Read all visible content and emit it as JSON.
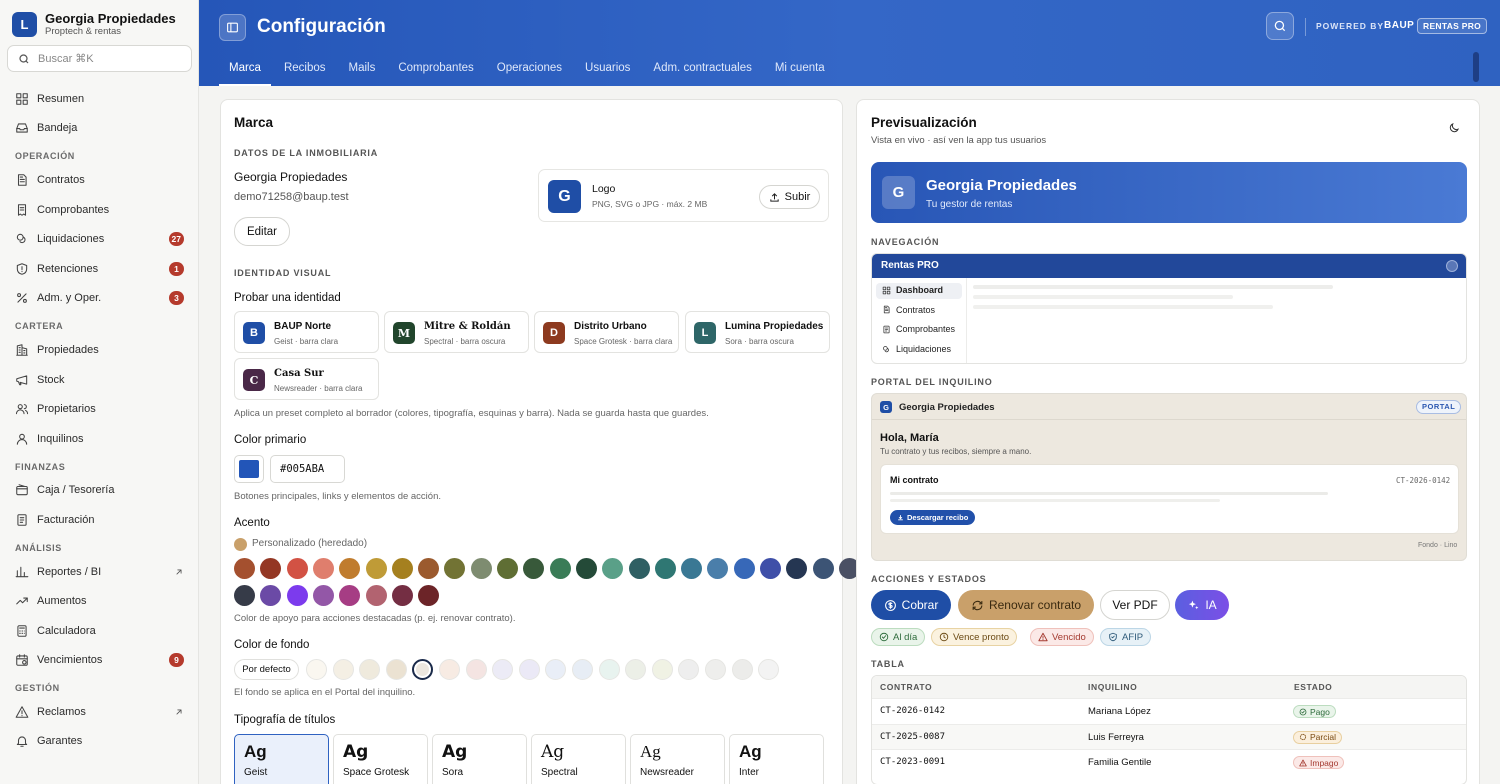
{
  "sidebar": {
    "brand_initial": "L",
    "brand_name": "Georgia Propiedades",
    "brand_sub": "Proptech & rentas",
    "search_placeholder": "Buscar ⌘K",
    "top_items": [
      {
        "label": "Resumen",
        "icon": "grid-icon"
      },
      {
        "label": "Bandeja",
        "icon": "inbox-icon"
      }
    ],
    "sections": [
      {
        "title": "OPERACIÓN",
        "items": [
          {
            "label": "Contratos",
            "icon": "document-icon"
          },
          {
            "label": "Comprobantes",
            "icon": "receipt-icon"
          },
          {
            "label": "Liquidaciones",
            "icon": "coins-icon",
            "badge": "27"
          },
          {
            "label": "Retenciones",
            "icon": "shield-icon",
            "badge": "1"
          },
          {
            "label": "Adm. y Oper.",
            "icon": "percent-icon",
            "badge": "3"
          }
        ]
      },
      {
        "title": "CARTERA",
        "items": [
          {
            "label": "Propiedades",
            "icon": "building-icon"
          },
          {
            "label": "Stock",
            "icon": "megaphone-icon"
          },
          {
            "label": "Propietarios",
            "icon": "users-icon"
          },
          {
            "label": "Inquilinos",
            "icon": "user-icon"
          }
        ]
      },
      {
        "title": "FINANZAS",
        "items": [
          {
            "label": "Caja / Tesorería",
            "icon": "wallet-icon"
          },
          {
            "label": "Facturación",
            "icon": "invoice-icon"
          }
        ]
      },
      {
        "title": "ANÁLISIS",
        "items": [
          {
            "label": "Reportes / BI",
            "icon": "chart-icon",
            "external": true
          },
          {
            "label": "Aumentos",
            "icon": "trend-icon"
          },
          {
            "label": "Calculadora",
            "icon": "calculator-icon"
          },
          {
            "label": "Vencimientos",
            "icon": "calendar-icon",
            "badge": "9"
          }
        ]
      },
      {
        "title": "GESTIÓN",
        "items": [
          {
            "label": "Reclamos",
            "icon": "warning-icon",
            "external": true
          },
          {
            "label": "Garantes",
            "icon": "bell-icon"
          }
        ]
      }
    ]
  },
  "header": {
    "title": "Configuración",
    "powered_by": "POWERED BY",
    "powered_brand": "BAUP",
    "pro_badge": "RENTAS PRO",
    "tabs": [
      "Marca",
      "Recibos",
      "Mails",
      "Comprobantes",
      "Operaciones",
      "Usuarios",
      "Adm. contractuales",
      "Mi cuenta"
    ],
    "active_tab": "Marca"
  },
  "marca": {
    "title": "Marca",
    "datos_label": "DATOS DE LA INMOBILIARIA",
    "company_name": "Georgia Propiedades",
    "email": "demo71258@baup.test",
    "edit_label": "Editar",
    "logo_initial": "G",
    "logo_title": "Logo",
    "logo_hint": "PNG, SVG o JPG · máx. 2 MB",
    "upload_label": "Subir",
    "identity_label": "IDENTIDAD VISUAL",
    "try_label": "Probar una identidad",
    "presets": [
      {
        "initial": "B",
        "name": "BAUP Norte",
        "sub": "Geist · barra clara",
        "color": "#1f4ea6"
      },
      {
        "initial": "M",
        "name": "Mitre & Roldán",
        "sub": "Spectral · barra oscura",
        "color": "#21452c"
      },
      {
        "initial": "D",
        "name": "Distrito Urbano",
        "sub": "Space Grotesk · barra clara",
        "color": "#8d3a1f"
      },
      {
        "initial": "L",
        "name": "Lumina Propiedades",
        "sub": "Sora · barra oscura",
        "color": "#2e6668"
      },
      {
        "initial": "C",
        "name": "Casa Sur",
        "sub": "Newsreader · barra clara",
        "color": "#4a2848"
      }
    ],
    "preset_hint": "Aplica un preset completo al borrador (colores, tipografía, esquinas y barra). Nada se guarda hasta que guardes.",
    "primary_label": "Color primario",
    "primary_color": "#2255B8",
    "primary_hex": "#005ABA",
    "primary_hint": "Botones principales, links y elementos de acción.",
    "accent_label": "Acento",
    "accent_custom": "Personalizado (heredado)",
    "accent_custom_color": "#c9a06a",
    "accent_colors": [
      "#a4502f",
      "#943724",
      "#d25244",
      "#df7e6d",
      "#c07c2e",
      "#bf9b37",
      "#a5801f",
      "#9b5a2e",
      "#727334",
      "#7e8c70",
      "#5f6e34",
      "#38593a",
      "#3a7c57",
      "#244a38",
      "#5aa088",
      "#2f5f63",
      "#2f7773",
      "#3a7894",
      "#4a7eaa",
      "#3768b8",
      "#3f4fa8",
      "#253652",
      "#3c5475",
      "#4a5064",
      "#363b48",
      "#6b4aa6",
      "#7c3bed",
      "#9357a7",
      "#a63d84",
      "#b26370",
      "#742e43",
      "#6c2428"
    ],
    "accent_hint": "Color de apoyo para acciones destacadas (p. ej. renovar contrato).",
    "bg_label": "Color de fondo",
    "bg_default": "Por defecto",
    "bg_colors": [
      "#faf7f0",
      "#f4efe4",
      "#efeadd",
      "#ebe2d2",
      "#ece7df",
      "#f7ebe3",
      "#f4e4e2",
      "#ecebf6",
      "#ebe9f6",
      "#e9eef7",
      "#e7edf5",
      "#e8f3ef",
      "#ecefe7",
      "#f0f2e4",
      "#eeeeee",
      "#eeeeec",
      "#ececea",
      "#f3f3f3"
    ],
    "bg_selected_index": 4,
    "bg_hint": "El fondo se aplica en el Portal del inquilino.",
    "typo_label": "Tipografía de títulos",
    "typo": [
      {
        "sample": "Ag",
        "name": "Geist"
      },
      {
        "sample": "Ag",
        "name": "Space Grotesk"
      },
      {
        "sample": "Ag",
        "name": "Sora"
      },
      {
        "sample": "Ag",
        "name": "Spectral"
      },
      {
        "sample": "Ag",
        "name": "Newsreader"
      },
      {
        "sample": "Ag",
        "name": "Inter"
      }
    ]
  },
  "preview": {
    "title": "Previsualización",
    "subtitle": "Vista en vivo · así ven la app tus usuarios",
    "hero_initial": "G",
    "hero_title": "Georgia Propiedades",
    "hero_sub": "Tu gestor de rentas",
    "nav_label": "NAVEGACIÓN",
    "nav_bar_title": "Rentas PRO",
    "nav_items": [
      "Dashboard",
      "Contratos",
      "Comprobantes",
      "Liquidaciones"
    ],
    "portal_label": "PORTAL DEL INQUILINO",
    "portal_initial": "G",
    "portal_company": "Georgia Propiedades",
    "portal_badge": "PORTAL",
    "portal_greeting": "Hola, María",
    "portal_sub": "Tu contrato y tus recibos, siempre a mano.",
    "portal_contract_title": "Mi contrato",
    "portal_contract_id": "CT-2026-0142",
    "portal_download": "Descargar recibo",
    "portal_footer": "Fondo · Lino",
    "actions_label": "ACCIONES Y ESTADOS",
    "btn_cobrar": "Cobrar",
    "btn_renovar": "Renovar contrato",
    "btn_pdf": "Ver PDF",
    "btn_ia": "IA",
    "chips": [
      {
        "label": "Al día",
        "fg": "#2d6b3b",
        "bg": "#e9f4ea",
        "bd": "#bcdcbf"
      },
      {
        "label": "Vence pronto",
        "fg": "#6b4a14",
        "bg": "#fbf2df",
        "bd": "#e8d3a3"
      },
      {
        "label": "Vencido",
        "fg": "#a43a30",
        "bg": "#fbe9e7",
        "bd": "#efc1bb"
      },
      {
        "label": "AFIP",
        "fg": "#2f5b7a",
        "bg": "#e7f1f7",
        "bd": "#bcd6e6"
      }
    ],
    "table_label": "TABLA",
    "table_headers": [
      "CONTRATO",
      "INQUILINO",
      "ESTADO"
    ],
    "table_rows": [
      {
        "contrato": "CT-2026-0142",
        "inquilino": "Mariana López",
        "estado": "Pago",
        "fg": "#2d6b3b",
        "bg": "#e9f4ea",
        "bd": "#bcdcbf"
      },
      {
        "contrato": "CT-2025-0087",
        "inquilino": "Luis Ferreyra",
        "estado": "Parcial",
        "fg": "#7a4b12",
        "bg": "#fbefdc",
        "bd": "#e8cf9f"
      },
      {
        "contrato": "CT-2023-0091",
        "inquilino": "Familia Gentile",
        "estado": "Impago",
        "fg": "#a43a30",
        "bg": "#fbe9e7",
        "bd": "#efc1bb"
      }
    ]
  }
}
